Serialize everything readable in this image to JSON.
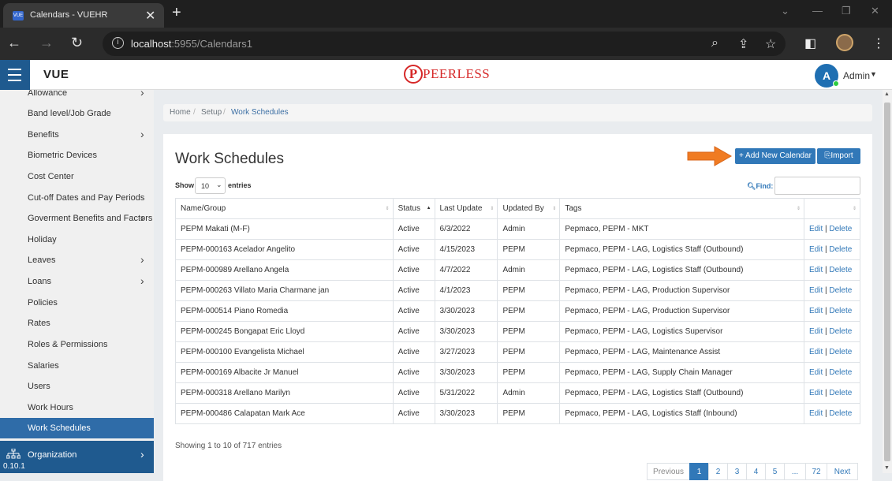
{
  "browser": {
    "tab_title": "Calendars - VUEHR",
    "favicon_text": "VUE",
    "url_host": "localhost",
    "url_path": ":5955/Calendars1"
  },
  "header": {
    "brand": "VUE",
    "logo_text": "PEERLESS",
    "logo_letter": "P",
    "admin_initial": "A",
    "admin_name": "Admin"
  },
  "sidebar": {
    "items": [
      {
        "label": "Allowance",
        "chevron": true
      },
      {
        "label": "Band level/Job Grade",
        "chevron": false
      },
      {
        "label": "Benefits",
        "chevron": true
      },
      {
        "label": "Biometric Devices",
        "chevron": false
      },
      {
        "label": "Cost Center",
        "chevron": false
      },
      {
        "label": "Cut-off Dates and Pay Periods",
        "chevron": false
      },
      {
        "label": "Goverment Benefits and Factors",
        "chevron": true
      },
      {
        "label": "Holiday",
        "chevron": false
      },
      {
        "label": "Leaves",
        "chevron": true
      },
      {
        "label": "Loans",
        "chevron": true
      },
      {
        "label": "Policies",
        "chevron": false
      },
      {
        "label": "Rates",
        "chevron": false
      },
      {
        "label": "Roles & Permissions",
        "chevron": false
      },
      {
        "label": "Salaries",
        "chevron": false
      },
      {
        "label": "Users",
        "chevron": false
      },
      {
        "label": "Work Hours",
        "chevron": false
      },
      {
        "label": "Work Schedules",
        "chevron": false,
        "active": true
      }
    ],
    "organization_label": "Organization",
    "version": "0.10.1"
  },
  "breadcrumb": {
    "home": "Home",
    "setup": "Setup",
    "current": "Work Schedules"
  },
  "main": {
    "title": "Work Schedules",
    "add_button": "+ Add New Calendar",
    "import_button": "Import",
    "show_label": "Show",
    "entries_value": "10",
    "entries_label": "entries",
    "find_label": "Find:",
    "find_value": "",
    "columns": [
      "Name/Group",
      "Status",
      "Last Update",
      "Updated By",
      "Tags",
      ""
    ],
    "sorted_column": "Status",
    "rows": [
      {
        "name": "PEPM Makati (M-F)",
        "status": "Active",
        "updated": "6/3/2022",
        "by": "Admin",
        "tags": "Pepmaco, PEPM - MKT"
      },
      {
        "name": "PEPM-000163 Acelador Angelito",
        "status": "Active",
        "updated": "4/15/2023",
        "by": "PEPM",
        "tags": "Pepmaco, PEPM - LAG, Logistics Staff (Outbound)"
      },
      {
        "name": "PEPM-000989 Arellano Angela",
        "status": "Active",
        "updated": "4/7/2022",
        "by": "Admin",
        "tags": "Pepmaco, PEPM - LAG, Logistics Staff (Outbound)"
      },
      {
        "name": "PEPM-000263 Villato Maria Charmane jan",
        "status": "Active",
        "updated": "4/1/2023",
        "by": "PEPM",
        "tags": "Pepmaco, PEPM - LAG, Production Supervisor"
      },
      {
        "name": "PEPM-000514 Piano Romedia",
        "status": "Active",
        "updated": "3/30/2023",
        "by": "PEPM",
        "tags": "Pepmaco, PEPM - LAG, Production Supervisor"
      },
      {
        "name": "PEPM-000245 Bongapat Eric Lloyd",
        "status": "Active",
        "updated": "3/30/2023",
        "by": "PEPM",
        "tags": "Pepmaco, PEPM - LAG, Logistics Supervisor"
      },
      {
        "name": "PEPM-000100 Evangelista Michael",
        "status": "Active",
        "updated": "3/27/2023",
        "by": "PEPM",
        "tags": "Pepmaco, PEPM - LAG, Maintenance Assist"
      },
      {
        "name": "PEPM-000169 Albacite Jr Manuel",
        "status": "Active",
        "updated": "3/30/2023",
        "by": "PEPM",
        "tags": "Pepmaco, PEPM - LAG, Supply Chain Manager"
      },
      {
        "name": "PEPM-000318 Arellano Marilyn",
        "status": "Active",
        "updated": "5/31/2022",
        "by": "Admin",
        "tags": "Pepmaco, PEPM - LAG, Logistics Staff (Outbound)"
      },
      {
        "name": "PEPM-000486 Calapatan Mark Ace",
        "status": "Active",
        "updated": "3/30/2023",
        "by": "PEPM",
        "tags": "Pepmaco, PEPM - LAG, Logistics Staff (Inbound)"
      }
    ],
    "edit_label": "Edit",
    "delete_label": "Delete",
    "info": "Showing 1 to 10 of 717 entries",
    "pagination": [
      "Previous",
      "1",
      "2",
      "3",
      "4",
      "5",
      "...",
      "72",
      "Next"
    ],
    "current_page": "1"
  },
  "colors": {
    "primary": "#3178b8",
    "sidebar_active": "#2f6ca8",
    "sidebar_dark": "#1f5a8f",
    "arrow": "#f07b22",
    "logo_red": "#d62828"
  }
}
